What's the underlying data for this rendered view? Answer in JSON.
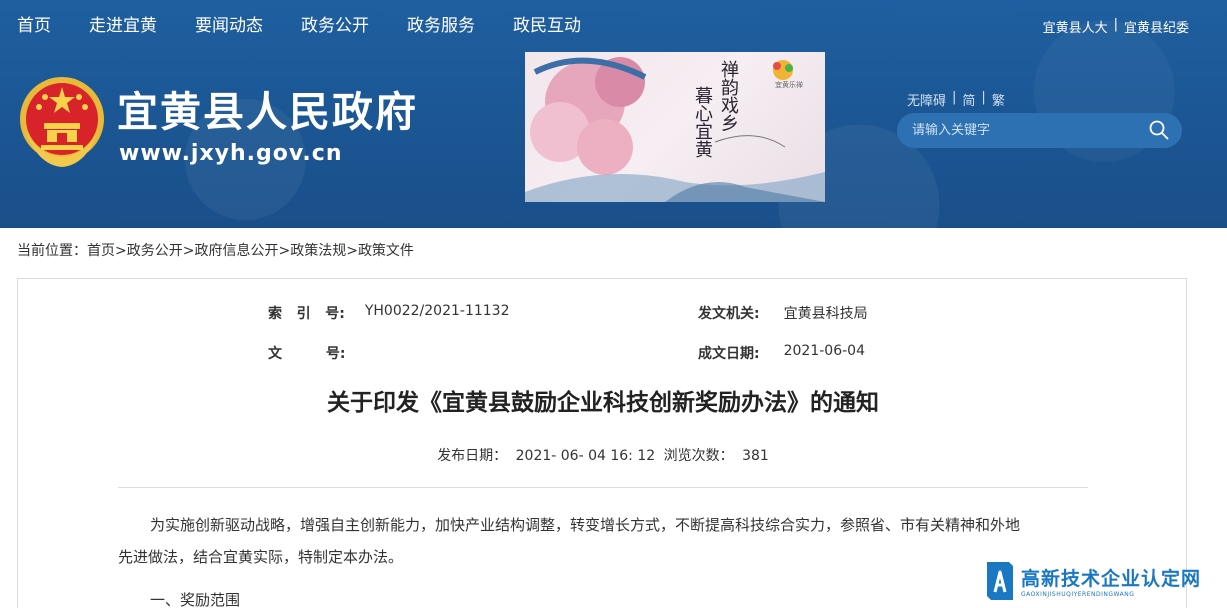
{
  "nav": {
    "items": [
      "首页",
      "走进宜黄",
      "要闻动态",
      "政务公开",
      "政务服务",
      "政民互动"
    ]
  },
  "toplinks": {
    "left": "宜黄县人大",
    "sep": "|",
    "right": "宜黄县纪委"
  },
  "site": {
    "title": "宜黄县人民政府",
    "url": "www.jxyh.gov.cn"
  },
  "banner": {
    "line1": "禅韵戏乡",
    "line2": "暮心宜黄",
    "brand": "宜黄乐禅"
  },
  "utility": {
    "accessible": "无障碍",
    "sep1": "|",
    "simplified": "简",
    "sep2": "|",
    "traditional": "繁"
  },
  "search": {
    "placeholder": "请输入关键字"
  },
  "breadcrumb": {
    "prefix": "当前位置：",
    "items": [
      "首页>",
      " 政务公开>",
      " 政府信息公开>",
      " 政策法规>",
      " 政策文件"
    ]
  },
  "meta": {
    "index_label": "索   引   号:",
    "index_value": "YH0022/2021-11132",
    "issuer_label": "发文机关:",
    "issuer_value": "宜黄县科技局",
    "docno_label": "文         号:",
    "docno_value": "",
    "date_label": "成文日期:",
    "date_value": "2021-06-04"
  },
  "doc": {
    "title": "关于印发《宜黄县鼓励企业科技创新奖励办法》的通知",
    "publish_label": "发布日期：",
    "publish_value": "2021- 06- 04 16: 12",
    "views_label": "浏览次数：",
    "views_value": "381",
    "para1_line1": "为实施创新驱动战略，增强自主创新能力，加快产业结构调整，转变增长方式，不断提高科技综合实力，参照省、市有关精神和外地",
    "para1_line2": "先进做法，结合宜黄实际，特制定本办法。",
    "section1": "一、奖励范围"
  },
  "watermark": {
    "main": "高新技术企业认定网",
    "sub": "GAOXINJISHUQIYERENDINGWANG"
  },
  "colors": {
    "header_blue": "#1b5592",
    "search_bg": "#2e71b2",
    "watermark_blue": "#1a78c2"
  }
}
